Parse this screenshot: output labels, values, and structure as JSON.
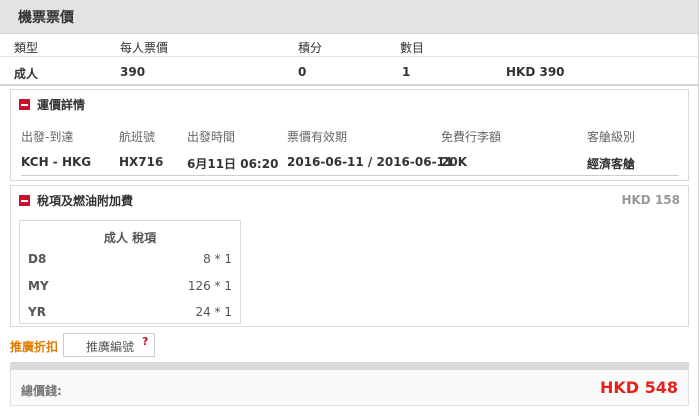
{
  "header": {
    "title": "機票票價"
  },
  "fare_table": {
    "columns": [
      "類型",
      "每人票價",
      "積分",
      "數目"
    ],
    "row": {
      "type": "成人",
      "price": "390",
      "points": "0",
      "count": "1",
      "total": "HKD 390"
    }
  },
  "fare_basis": {
    "title": "運價詳情",
    "columns": [
      "出發-到達",
      "航班號",
      "出發時間",
      "票價有效期",
      "免費行李額",
      "客艙級別"
    ],
    "row": {
      "route": "KCH - HKG",
      "flight": "HX716",
      "departure": "6月11日 06:20",
      "validity": "2016-06-11 / 2016-06-11",
      "baggage": "20K",
      "cabin": "經濟客艙"
    }
  },
  "taxes": {
    "title": "稅項及燃油附加費",
    "total": "HKD 158",
    "table_title": "成人 稅項",
    "rows": [
      {
        "code": "D8",
        "value": "8 * 1"
      },
      {
        "code": "MY",
        "value": "126 * 1"
      },
      {
        "code": "YR",
        "value": "24 * 1"
      }
    ]
  },
  "promo": {
    "label": "推廣折扣",
    "placeholder": "推廣編號",
    "help": "?"
  },
  "total": {
    "label": "總價錢:",
    "value": "HKD 548"
  },
  "colors": {
    "accent_red": "#e4211b",
    "promo_orange": "#e07b00",
    "icon_red": "#c8102e"
  }
}
